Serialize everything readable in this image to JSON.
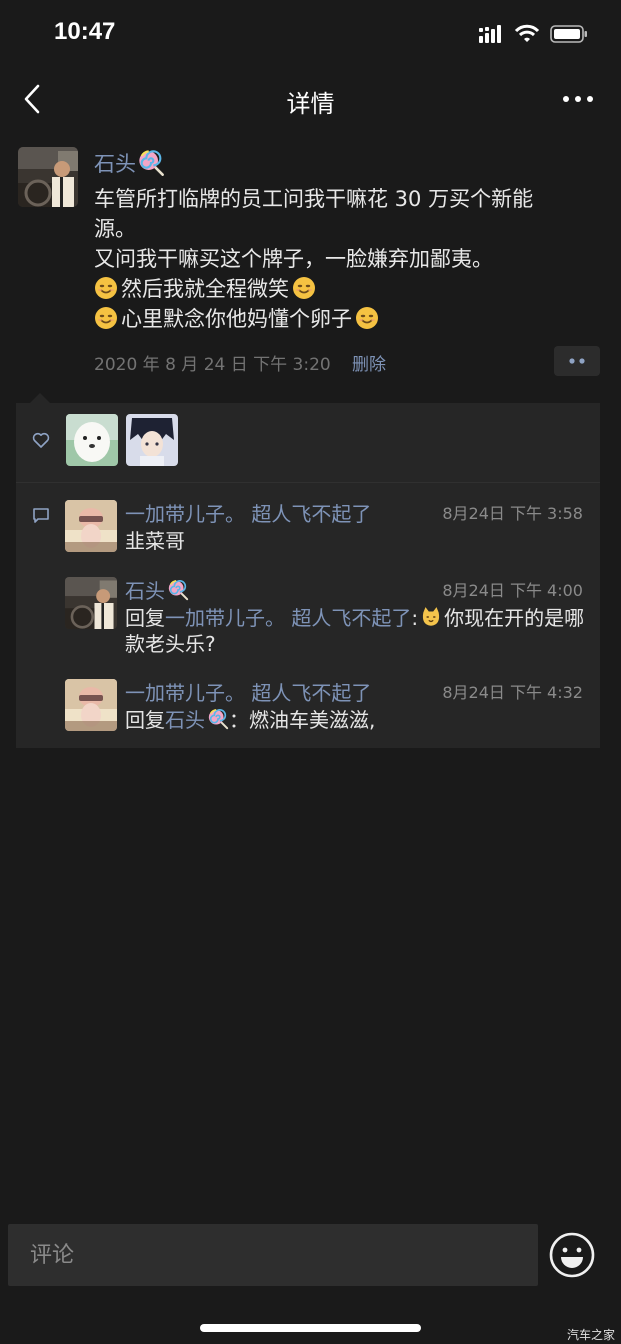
{
  "status_bar": {
    "time": "10:47"
  },
  "nav": {
    "title": "详情"
  },
  "post": {
    "author": "石头",
    "lines": [
      {
        "text": "车管所打临牌的员工问我干嘛花 30 万买个新能",
        "emoji": false
      },
      {
        "text": "源。",
        "emoji": false
      },
      {
        "text": "又问我干嘛买这个牌子，一脸嫌弃加鄙夷。",
        "emoji": false
      },
      {
        "text": "然后我就全程微笑",
        "emoji": true
      },
      {
        "text": "心里默念你他妈懂个卵子",
        "emoji": true
      }
    ],
    "timestamp": "2020 年 8 月 24 日  下午 3:20",
    "delete_label": "删除"
  },
  "comments": [
    {
      "author": "一加带儿子。 超人飞不起了",
      "time": "8月24日 下午 3:58",
      "text": "韭菜哥",
      "avatar": "cat"
    },
    {
      "author": "石头",
      "time": "8月24日 下午 4:00",
      "reply_prefix": "回复",
      "reply_to": "一加带儿子。 超人飞不起了",
      "text": "你现在开的是哪款老头乐?",
      "avatar": "driver"
    },
    {
      "author": "一加带儿子。 超人飞不起了",
      "time": "8月24日 下午 4:32",
      "reply_prefix": "回复",
      "reply_to": "石头",
      "text": "：燃油车美滋滋,",
      "avatar": "cat"
    }
  ],
  "input": {
    "placeholder": "评论"
  },
  "watermark": "汽车之家",
  "colors": {
    "background": "#1a1a1a",
    "link": "#7e93b7",
    "card": "#262626"
  }
}
